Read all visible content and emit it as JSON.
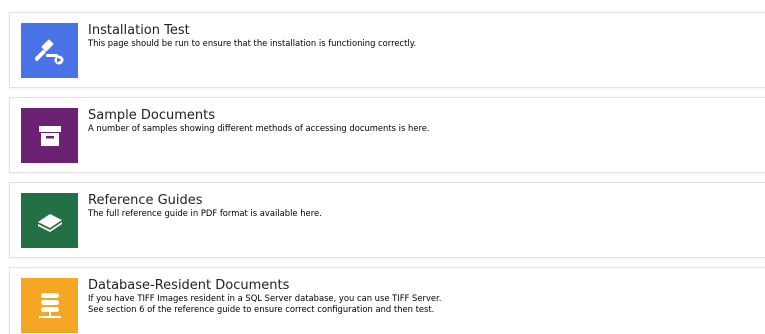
{
  "cards": [
    {
      "title": "Installation Test",
      "description": "This page should be run to ensure that the installation is functioning correctly.",
      "icon": "gavel-icon",
      "color": "#4a73e8"
    },
    {
      "title": "Sample Documents",
      "description": "A number of samples showing different methods of accessing documents is here.",
      "icon": "archive-icon",
      "color": "#6b2272"
    },
    {
      "title": "Reference Guides",
      "description": "The full reference guide in PDF format is available here.",
      "icon": "book-icon",
      "color": "#237044"
    },
    {
      "title": "Database-Resident Documents",
      "description_lines": [
        "If you have TIFF Images resident in a SQL Server database, you can use TIFF Server.",
        "See section 6 of the reference guide to ensure correct configuration and then test."
      ],
      "icon": "database-icon",
      "color": "#f5a623"
    }
  ]
}
